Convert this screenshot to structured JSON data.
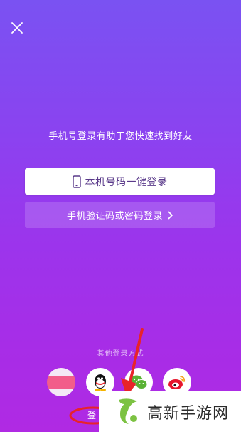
{
  "tagline": "手机号登录有助于您快速找到好友",
  "buttons": {
    "one_click": "本机号码一键登录",
    "sms_or_password": "手机验证码或密码登录"
  },
  "other_login": {
    "label": "其他登录方式",
    "options": [
      "phone",
      "qq-icon",
      "wechat-icon",
      "weibo-icon"
    ]
  },
  "login_hint": "登",
  "watermark": {
    "text": "高新手游网"
  },
  "colors": {
    "gradient_top": "#7a52f2",
    "gradient_bottom": "#b02ae3",
    "highlight_red": "#e8232a",
    "watermark_green": "#7cc242"
  }
}
